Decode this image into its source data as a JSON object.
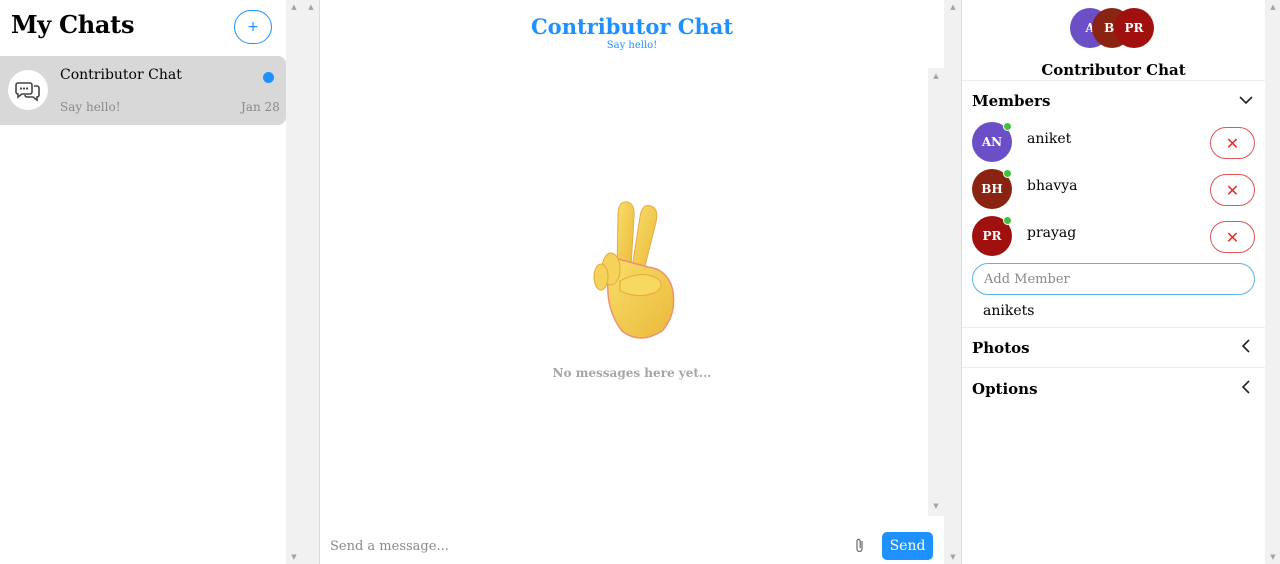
{
  "sidebar": {
    "title": "My Chats",
    "new_chat_label": "+",
    "chats": [
      {
        "name": "Contributor Chat",
        "preview": "Say hello!",
        "date": "Jan 28",
        "unread": true
      }
    ]
  },
  "main": {
    "title": "Contributor Chat",
    "subtitle": "Say hello!",
    "empty_message": "No messages here yet...",
    "empty_icon": "victory-hand-emoji",
    "composer": {
      "placeholder": "Send a message...",
      "send_label": "Send",
      "attach_icon": "paperclip-icon"
    }
  },
  "details": {
    "avatars": [
      {
        "initials": "A",
        "color": "#6a4fc7"
      },
      {
        "initials": "BI",
        "color": "#8b2312"
      },
      {
        "initials": "PR",
        "color": "#a0100f"
      }
    ],
    "title": "Contributor Chat",
    "members_label": "Members",
    "members": [
      {
        "initials": "AN",
        "name": "aniket",
        "color": "#6a4fc7",
        "online": true,
        "remove_label": "✕"
      },
      {
        "initials": "BH",
        "name": "bhavya",
        "color": "#8b2312",
        "online": true,
        "remove_label": "✕"
      },
      {
        "initials": "PR",
        "name": "prayag",
        "color": "#a0100f",
        "online": true,
        "remove_label": "✕"
      }
    ],
    "add_member_placeholder": "Add Member",
    "suggestions": [
      "anikets"
    ],
    "photos_label": "Photos",
    "options_label": "Options"
  },
  "colors": {
    "accent": "#1e90ff",
    "danger": "#e03030",
    "online": "#3ec33e",
    "selected_chat_bg": "#d8d8d8"
  }
}
